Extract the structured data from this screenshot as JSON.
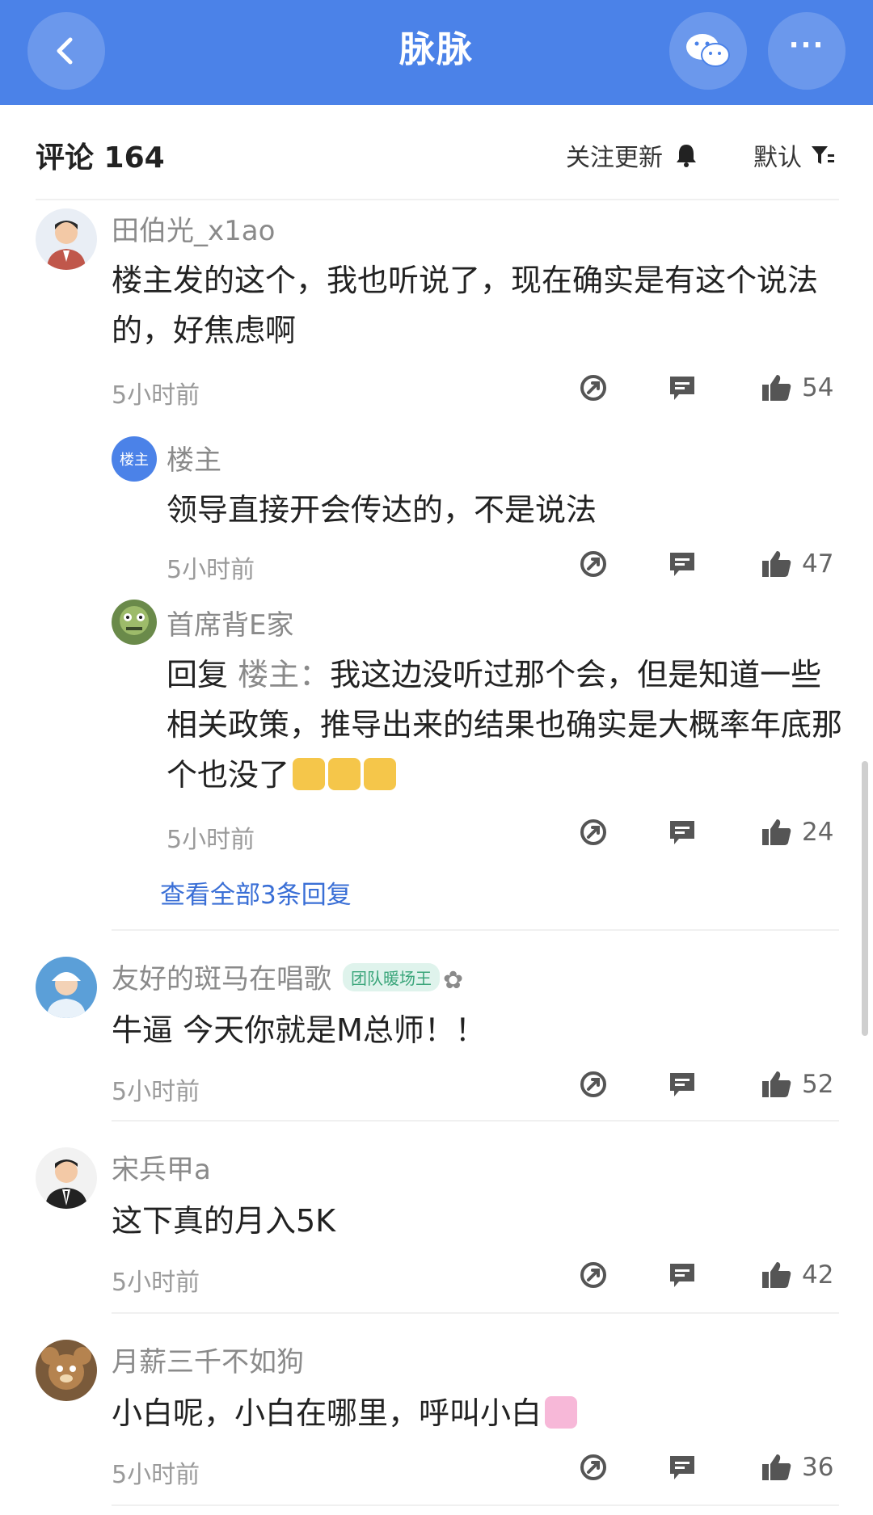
{
  "header": {
    "title": "脉脉"
  },
  "subheader": {
    "comments_label": "评论 164",
    "follow_label": "关注更新",
    "sort_label": "默认"
  },
  "comments": [
    {
      "user": "田伯光_x1ao",
      "text": "楼主发的这个，我也听说了，现在确实是有这个说法的，好焦虑啊",
      "time": "5小时前",
      "likes": "54"
    },
    {
      "user": "楼主",
      "badge": "楼主",
      "text": "领导直接开会传达的，不是说法",
      "time": "5小时前",
      "likes": "47"
    },
    {
      "user": "首席背E家",
      "reply_prefix": "回复 ",
      "reply_to": "楼主：",
      "text": "我这边没听过那个会，但是知道一些相关政策，推导出来的结果也确实是大概率年底那个也没了",
      "time": "5小时前",
      "likes": "24"
    },
    {
      "user": "友好的斑马在唱歌",
      "badge": "团队暖场王",
      "text": "牛逼 今天你就是M总师！！",
      "time": "5小时前",
      "likes": "52"
    },
    {
      "user": "宋兵甲a",
      "text": "这下真的月入5K",
      "time": "5小时前",
      "likes": "42"
    },
    {
      "user": "月薪三千不如狗",
      "text": "小白呢，小白在哪里，呼叫小白",
      "time": "5小时前",
      "likes": "36"
    }
  ],
  "view_all_replies": "查看全部3条回复",
  "icons": [
    "back-icon",
    "wechat-icon",
    "more-icon",
    "bell-icon",
    "filter-icon",
    "share-icon",
    "comment-icon",
    "thumbs-up-icon"
  ],
  "colors": {
    "accent": "#4b82e8",
    "link": "#3a6fd6"
  }
}
